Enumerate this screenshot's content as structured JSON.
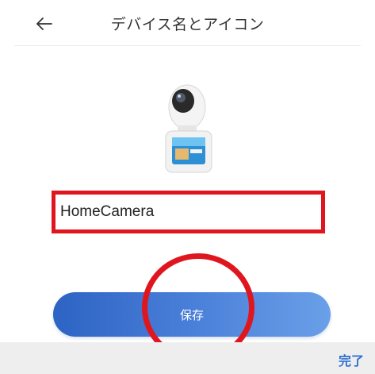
{
  "header": {
    "title": "デバイス名とアイコン",
    "back_icon": "arrow-left-icon"
  },
  "device": {
    "icon": "camera-device-image"
  },
  "name_field": {
    "value": "HomeCamera"
  },
  "save_button": {
    "label": "保存"
  },
  "footer": {
    "done_label": "完了"
  },
  "annotations": {
    "highlight_color": "#e0161f"
  },
  "colors": {
    "accent": "#3d6fd8",
    "done_text": "#2f6fd2"
  }
}
